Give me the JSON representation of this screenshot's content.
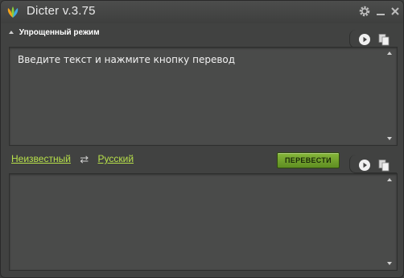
{
  "app": {
    "title": "Dicter v.3.75"
  },
  "mode": {
    "label": "Упрощенный режим"
  },
  "input": {
    "placeholder_text": "Введите текст и нажмите кнопку перевод"
  },
  "languages": {
    "source": "Неизвестный",
    "target": "Русский"
  },
  "actions": {
    "translate_label": "ПЕРЕВЕСТИ"
  },
  "icons": {
    "logo": "dicter-logo-icon",
    "settings": "gear-icon",
    "minimize": "minimize-icon",
    "close": "close-icon",
    "play": "play-icon",
    "copy": "copy-icon",
    "swap": "swap-arrows-icon"
  },
  "colors": {
    "accent_green": "#b7e04a",
    "button_green": "#6e9f2c"
  }
}
